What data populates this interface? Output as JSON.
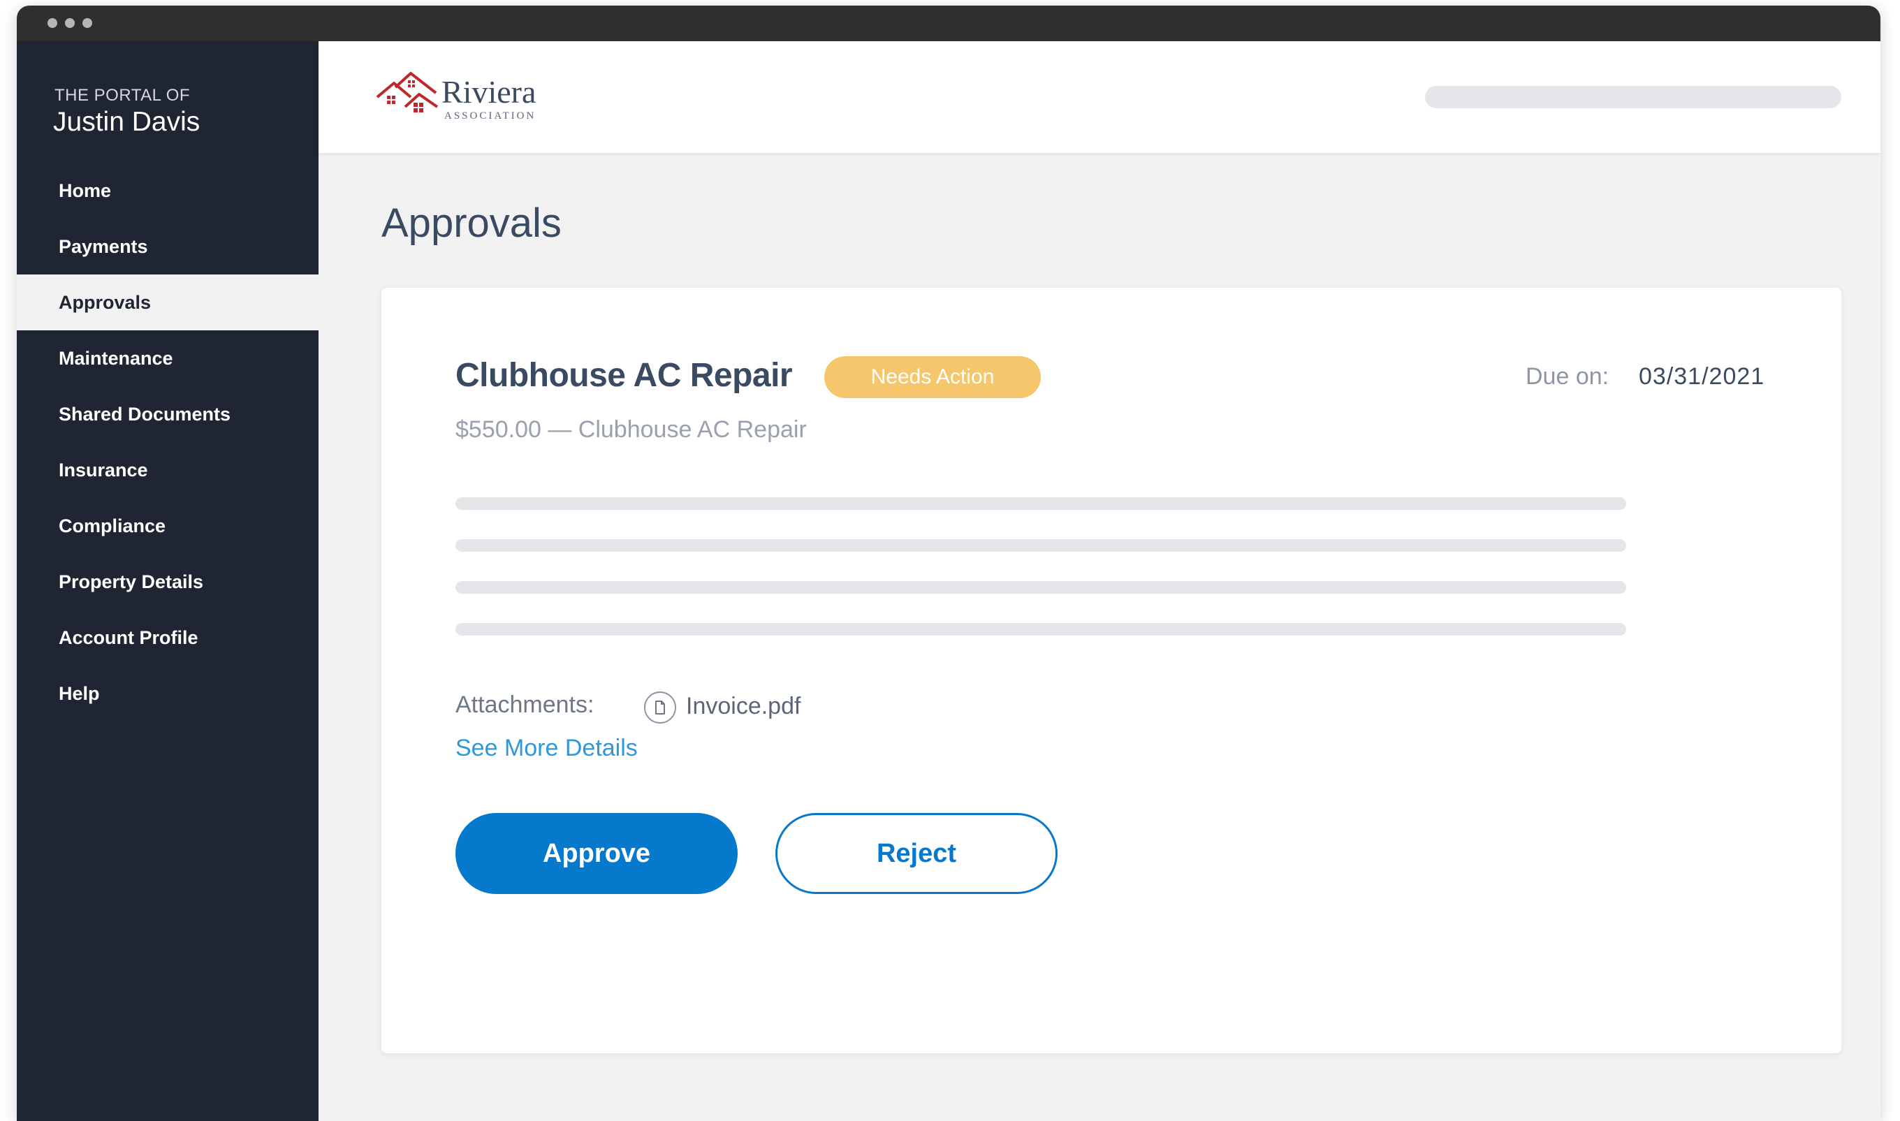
{
  "sidebar": {
    "portal_label": "THE PORTAL OF",
    "user_name": "Justin Davis",
    "items": [
      {
        "label": "Home"
      },
      {
        "label": "Payments"
      },
      {
        "label": "Approvals",
        "active": true
      },
      {
        "label": "Maintenance"
      },
      {
        "label": "Shared Documents"
      },
      {
        "label": "Insurance"
      },
      {
        "label": "Compliance"
      },
      {
        "label": "Property Details"
      },
      {
        "label": "Account Profile"
      },
      {
        "label": "Help"
      }
    ]
  },
  "header": {
    "logo_name": "Riviera",
    "logo_subtitle": "ASSOCIATION",
    "logo_color": "#c0272d"
  },
  "page": {
    "title": "Approvals"
  },
  "approval": {
    "title": "Clubhouse AC Repair",
    "status": "Needs Action",
    "status_color": "#f5c66c",
    "due_label": "Due on:",
    "due_date": "03/31/2021",
    "subtitle": "$550.00 — Clubhouse AC Repair",
    "attachments_label": "Attachments:",
    "attachment_icon": "document-icon",
    "attachment_file": "Invoice.pdf",
    "see_more": "See More Details",
    "approve_label": "Approve",
    "reject_label": "Reject",
    "accent_color": "#0779cc"
  }
}
